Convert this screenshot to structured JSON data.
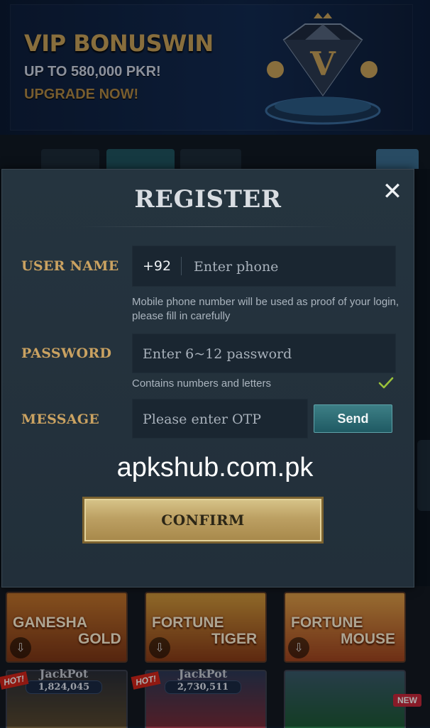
{
  "banner": {
    "title": "VIP BONUSWIN",
    "line1": "UP TO 580,000 PKR!",
    "line2": "UPGRADE NOW!"
  },
  "modal": {
    "title": "REGISTER",
    "username": {
      "label": "USER NAME",
      "prefix": "+92",
      "placeholder": "Enter phone",
      "hint": "Mobile phone number will be used as proof of your login, please fill in carefully"
    },
    "password": {
      "label": "PASSWORD",
      "placeholder": "Enter 6~12 password",
      "hint": "Contains numbers and letters"
    },
    "message": {
      "label": "MESSAGE",
      "placeholder": "Please enter OTP",
      "send_label": "Send"
    },
    "confirm_label": "CONFIRM"
  },
  "watermark": "apkshub.com.pk",
  "games": [
    {
      "name_line1": "GANESHA",
      "name_line2": "GOLD"
    },
    {
      "name_line1": "FORTUNE",
      "name_line2": "TIGER"
    },
    {
      "name_line1": "FORTUNE",
      "name_line2": "MOUSE"
    }
  ],
  "jackpots": [
    {
      "title": "JackPot",
      "value": "1,824,045"
    },
    {
      "title": "JackPot",
      "value": "2,730,511"
    }
  ],
  "badges": {
    "hot": "HOT!",
    "new": "NEW"
  },
  "colors": {
    "gold": "#caa261",
    "modal_bg": "#25343f",
    "send_teal": "#2f6f77",
    "check_green": "#9ac23a"
  },
  "icons": {
    "close": "close-icon",
    "check": "check-icon",
    "download": "download-icon"
  }
}
